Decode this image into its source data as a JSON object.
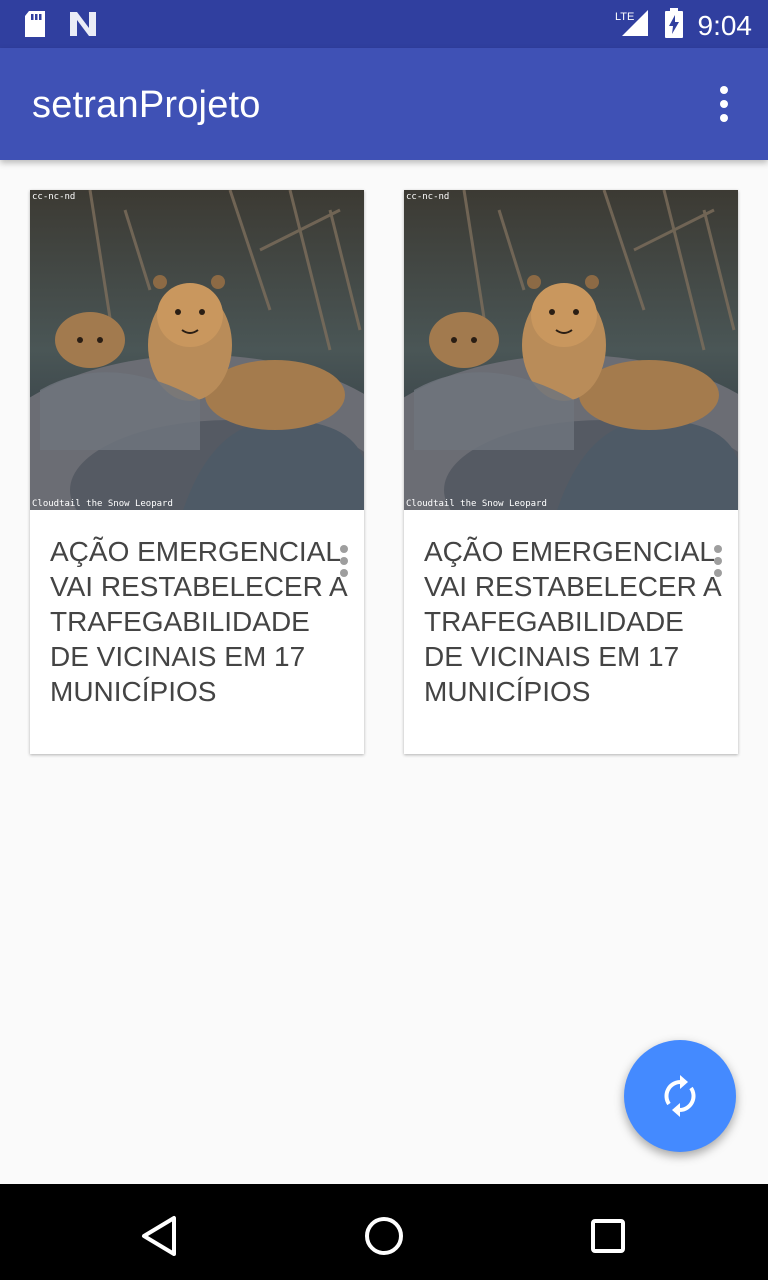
{
  "status_bar": {
    "time": "9:04",
    "network": "LTE",
    "icons": [
      "sd-card-icon",
      "n-logo-icon",
      "lte-signal-icon",
      "battery-charging-icon"
    ]
  },
  "app_bar": {
    "title": "setranProjeto",
    "menu_icon": "overflow-menu-icon"
  },
  "cards": [
    {
      "image_caption_top": "cc-nc-nd",
      "image_caption_bottom": "Cloudtail the Snow Leopard",
      "title": "AÇÃO EMERGENCIAL VAI RESTABELECER A TRAFEGABILIDADE DE VICINAIS EM 17 MUNICÍPIOS"
    },
    {
      "image_caption_top": "cc-nc-nd",
      "image_caption_bottom": "Cloudtail the Snow Leopard",
      "title": "AÇÃO EMERGENCIAL VAI RESTABELECER A TRAFEGABILIDADE DE VICINAIS EM 17 MUNICÍPIOS"
    }
  ],
  "fab": {
    "icon": "refresh-icon"
  },
  "nav_bar": {
    "icons": [
      "back-icon",
      "home-icon",
      "recents-icon"
    ]
  },
  "colors": {
    "primary": "#3f51b5",
    "primary_dark": "#303f9f",
    "accent": "#448aff",
    "background": "#fafafa"
  }
}
